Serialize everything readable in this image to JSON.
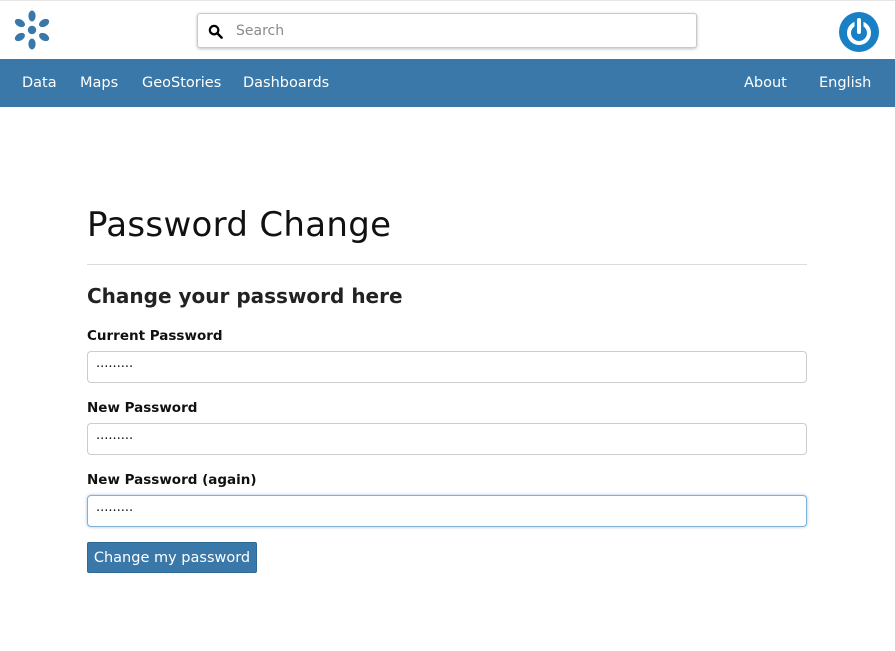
{
  "header": {
    "logo_icon": "geonode-logo-icon",
    "search": {
      "placeholder": "Search",
      "value": "",
      "icon": "search-icon"
    },
    "power_icon": "power-icon",
    "brand_color": "#3978a8"
  },
  "nav": {
    "left": [
      "Data",
      "Maps",
      "GeoStories",
      "Dashboards"
    ],
    "right": [
      "About",
      "English"
    ]
  },
  "main": {
    "title": "Password Change",
    "subtitle": "Change your password here",
    "fields": [
      {
        "label": "Current Password",
        "value": "·········"
      },
      {
        "label": "New Password",
        "value": "·········"
      },
      {
        "label": "New Password (again)",
        "value": "·········"
      }
    ],
    "submit_label": "Change my password"
  }
}
